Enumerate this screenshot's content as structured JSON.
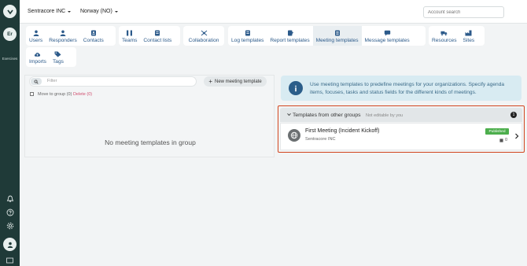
{
  "sidebar": {
    "avatar_initials": "Er",
    "exercises_label": "Exercises"
  },
  "header": {
    "org_dropdown": "Sentracore INC",
    "region_dropdown": "Norway (NO)",
    "account_search_placeholder": "Account search"
  },
  "nav": {
    "groups": [
      {
        "tabs": [
          {
            "label": "Users",
            "icon": "users-icon"
          },
          {
            "label": "Responders",
            "icon": "responder-icon"
          },
          {
            "label": "Contacts",
            "icon": "contact-card-icon"
          }
        ]
      },
      {
        "tabs": [
          {
            "label": "Teams",
            "icon": "teams-icon"
          },
          {
            "label": "Contact lists",
            "icon": "contact-list-icon"
          }
        ]
      },
      {
        "tabs": [
          {
            "label": "Collaboration",
            "icon": "collaboration-icon"
          }
        ]
      },
      {
        "tabs": [
          {
            "label": "Log templates",
            "icon": "log-icon"
          },
          {
            "label": "Report templates",
            "icon": "report-icon"
          },
          {
            "label": "Meeting templates",
            "icon": "meeting-icon",
            "active": true
          },
          {
            "label": "Message templates",
            "icon": "message-icon"
          }
        ]
      },
      {
        "tabs": [
          {
            "label": "Resources",
            "icon": "truck-icon"
          },
          {
            "label": "Sites",
            "icon": "factory-icon"
          }
        ]
      },
      {
        "tabs": [
          {
            "label": "Imports",
            "icon": "cloud-upload-icon"
          },
          {
            "label": "Tags",
            "icon": "tag-icon"
          }
        ]
      }
    ]
  },
  "left": {
    "filter_placeholder": "Filter",
    "new_button": "New meeting template",
    "move_label": "Move to group (0)",
    "delete_label": "Delete (0)",
    "empty_text": "No meeting templates in group"
  },
  "info": {
    "text": "Use meeting templates to predefine meetings for your organizations. Specify agenda items, focuses, tasks and status fields for the different kinds of meetings."
  },
  "other_groups": {
    "title": "Templates from other groups",
    "subtitle": "Not editable by you",
    "count": "1",
    "items": [
      {
        "title": "First Meeting (Incident Kickoff)",
        "org": "Sentracore INC",
        "status": "Published",
        "count": "0"
      }
    ]
  },
  "colors": {
    "rail": "#1f3a38",
    "accent": "#2c5a8a",
    "highlight_border": "#d2461f",
    "published": "#4cae4c"
  }
}
